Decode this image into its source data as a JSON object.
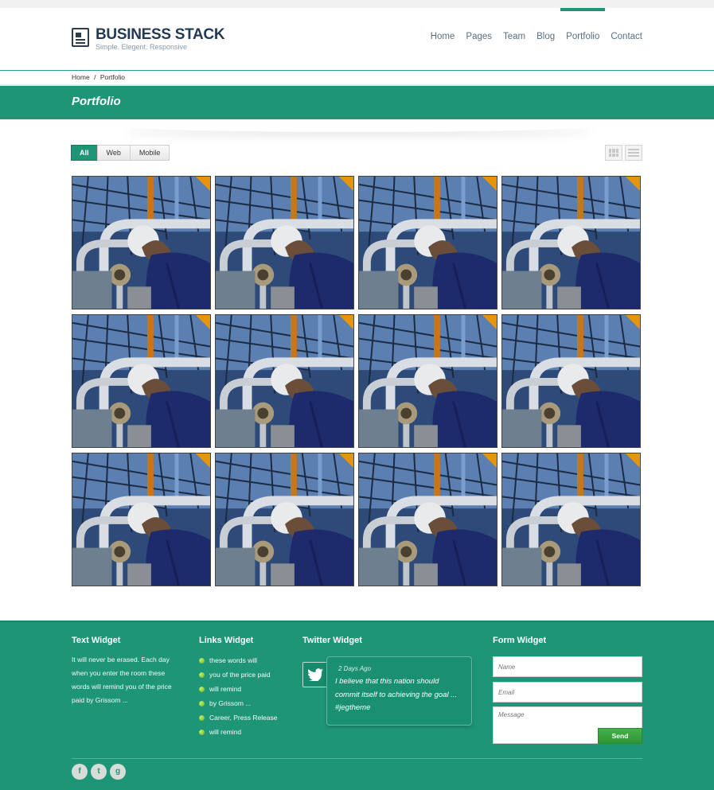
{
  "brand": {
    "title": "BUSINESS STACK",
    "tagline": "Simple. Elegent. Responsive"
  },
  "nav": {
    "items": [
      {
        "label": "Home"
      },
      {
        "label": "Pages"
      },
      {
        "label": "Team"
      },
      {
        "label": "Blog"
      },
      {
        "label": "Portfolio",
        "active": true
      },
      {
        "label": "Contact"
      }
    ]
  },
  "breadcrumb": {
    "home": "Home",
    "separator": "/",
    "current": "Portfolio"
  },
  "page": {
    "title": "Portfolio"
  },
  "filters": {
    "items": [
      {
        "label": "All",
        "active": true
      },
      {
        "label": "Web"
      },
      {
        "label": "Mobile"
      }
    ]
  },
  "view_toggles": [
    "grid-view-icon",
    "list-view-icon"
  ],
  "portfolio": {
    "rows": 3,
    "columns": 4,
    "items": 12
  },
  "footer": {
    "text_widget": {
      "title": "Text Widget",
      "body": "It will never be erased. Each day when you enter the room these words will remind you of the price paid by Grissom ..."
    },
    "links_widget": {
      "title": "Links Widget",
      "links": [
        "these words will",
        "you of the price paid",
        "will remind",
        "by Grissom ...",
        "Career, Press Release",
        "will remind"
      ]
    },
    "twitter_widget": {
      "title": "Twitter Widget",
      "time": "2 Days Ago",
      "text": "I believe that this nation should commit itself to achieving the goal ... #jegtheme"
    },
    "form_widget": {
      "title": "Form Widget",
      "name_placeholder": "Name",
      "email_placeholder": "Email",
      "message_placeholder": "Message",
      "send_label": "Send"
    },
    "social": [
      {
        "icon": "facebook-icon",
        "glyph": "f"
      },
      {
        "icon": "twitter-icon",
        "glyph": "t"
      },
      {
        "icon": "google-plus-icon",
        "glyph": "g"
      }
    ]
  },
  "colors": {
    "brand_green": "#1e9577",
    "accent_orange": "#e6950a",
    "send_green": "#3aa53e",
    "logo_navy": "#233a52"
  }
}
